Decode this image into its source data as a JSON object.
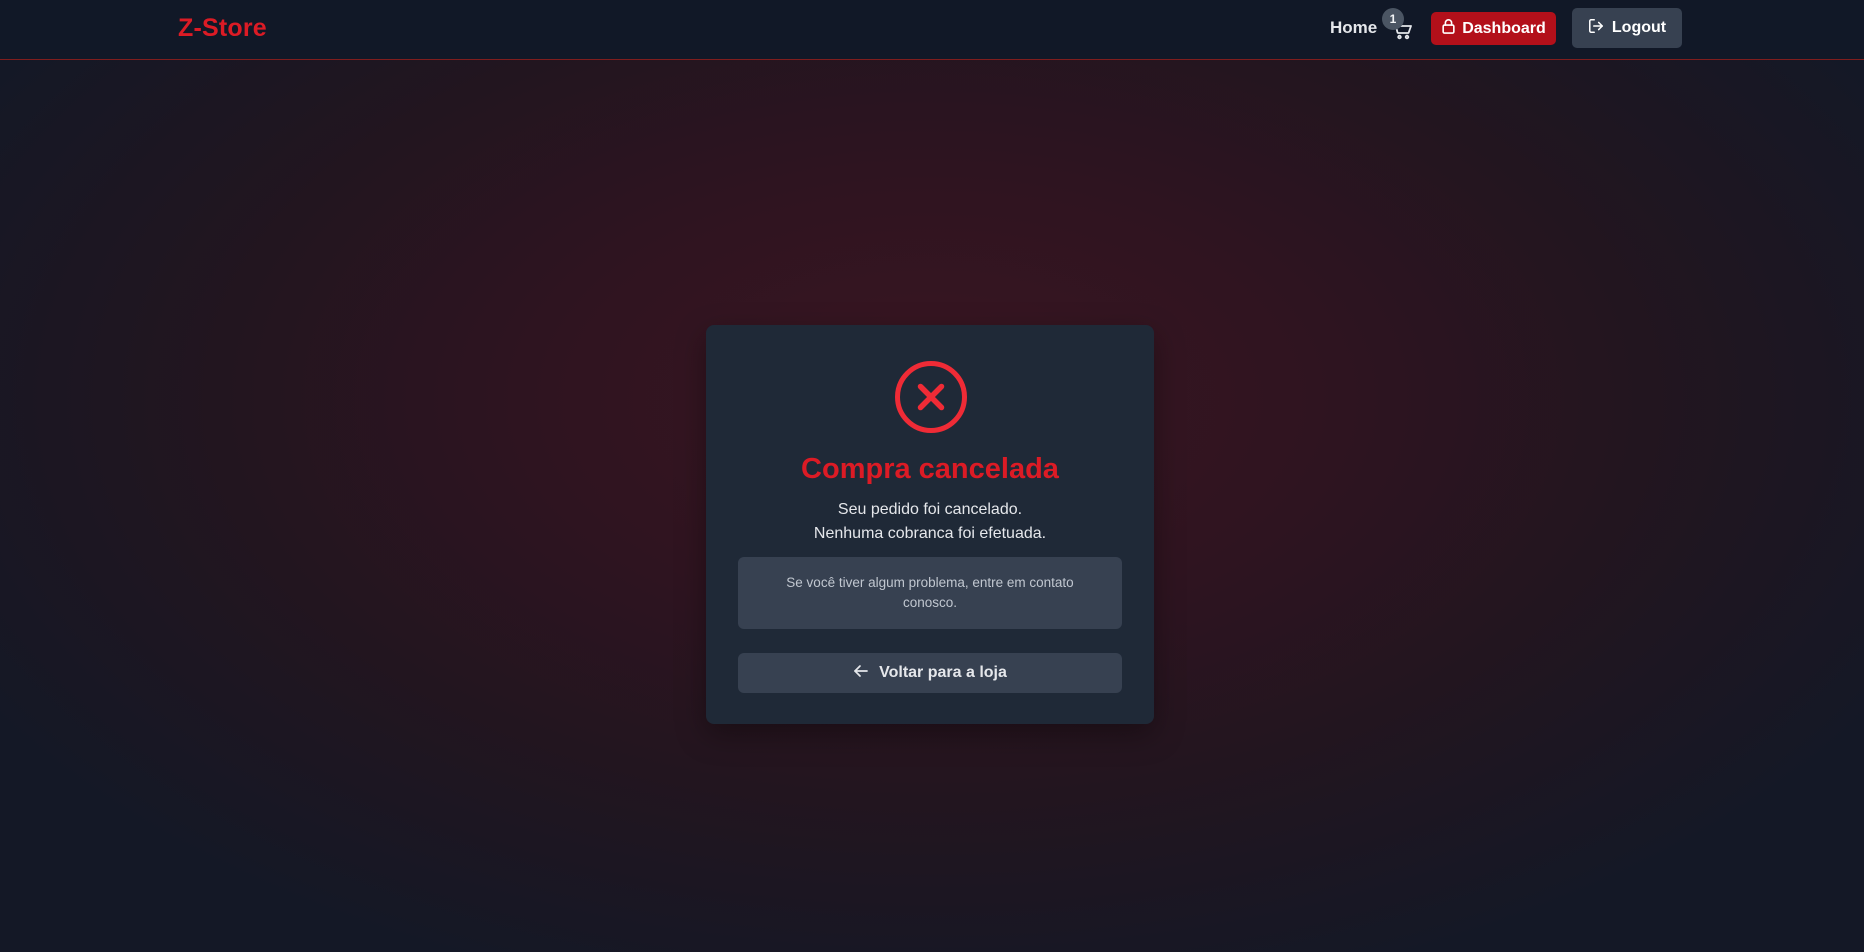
{
  "header": {
    "brand": "Z-Store",
    "home_label": "Home",
    "cart_count": "1",
    "cart_icon": "cart-icon",
    "dashboard_label": "Dashboard",
    "dashboard_icon": "lock-icon",
    "logout_label": "Logout",
    "logout_icon": "logout-icon"
  },
  "card": {
    "status_icon": "x-circle-icon",
    "title": "Compra cancelada",
    "message_line1": "Seu pedido foi cancelado.",
    "message_line2": "Nenhuma cobranca foi efetuada.",
    "info_text": "Se você tiver algum problema, entre em contato conosco.",
    "back_label": "Voltar para a loja",
    "back_icon": "arrow-left-icon"
  },
  "colors": {
    "brand_red": "#dc1b25",
    "dashboard_button": "#b3101a",
    "navbar_bg": "#111827",
    "card_bg": "#1f2937",
    "secondary_button": "#374151"
  }
}
